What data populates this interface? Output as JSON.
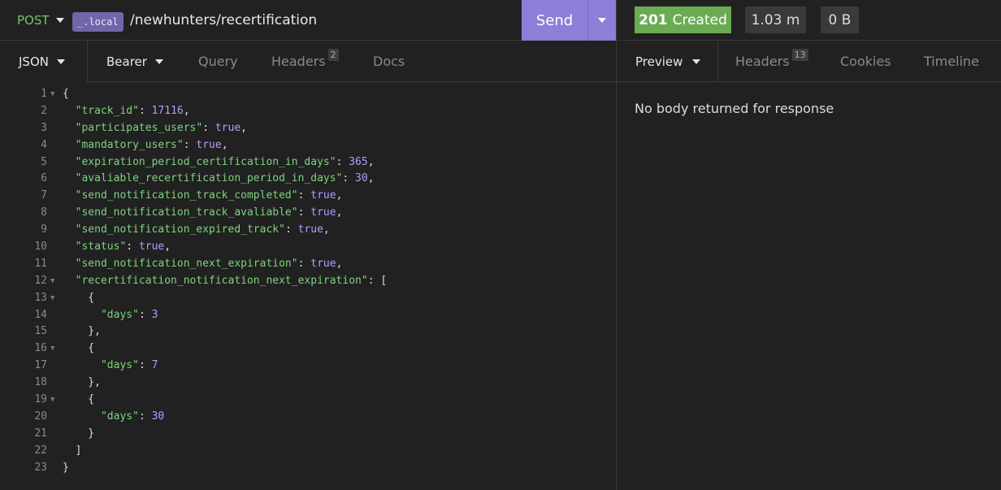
{
  "request": {
    "method": "POST",
    "env_chip": "_.local",
    "path": "/newhunters/recertification",
    "send_label": "Send"
  },
  "request_tabs": {
    "body": "JSON",
    "auth": "Bearer",
    "query": "Query",
    "headers": "Headers",
    "headers_count": "2",
    "docs": "Docs"
  },
  "editor": {
    "lines": [
      {
        "n": "1",
        "fold": "▼",
        "html": "{"
      },
      {
        "n": "2",
        "fold": "",
        "html": "  <span class=\"k\">\"track_id\"</span>: <span class=\"n\">17116</span>,"
      },
      {
        "n": "3",
        "fold": "",
        "html": "  <span class=\"k\">\"participates_users\"</span>: <span class=\"b\">true</span>,"
      },
      {
        "n": "4",
        "fold": "",
        "html": "  <span class=\"k\">\"mandatory_users\"</span>: <span class=\"b\">true</span>,"
      },
      {
        "n": "5",
        "fold": "",
        "html": "  <span class=\"k\">\"expiration_period_certification_in_days\"</span>: <span class=\"n\">365</span>,"
      },
      {
        "n": "6",
        "fold": "",
        "html": "  <span class=\"k\">\"avaliable_recertification_period_in_days\"</span>: <span class=\"n\">30</span>,"
      },
      {
        "n": "7",
        "fold": "",
        "html": "  <span class=\"k\">\"send_notification_track_completed\"</span>: <span class=\"b\">true</span>,"
      },
      {
        "n": "8",
        "fold": "",
        "html": "  <span class=\"k\">\"send_notification_track_avaliable\"</span>: <span class=\"b\">true</span>,"
      },
      {
        "n": "9",
        "fold": "",
        "html": "  <span class=\"k\">\"send_notification_expired_track\"</span>: <span class=\"b\">true</span>,"
      },
      {
        "n": "10",
        "fold": "",
        "html": "  <span class=\"k\">\"status\"</span>: <span class=\"b\">true</span>,"
      },
      {
        "n": "11",
        "fold": "",
        "html": "  <span class=\"k\">\"send_notification_next_expiration\"</span>: <span class=\"b\">true</span>,"
      },
      {
        "n": "12",
        "fold": "▼",
        "html": "  <span class=\"k\">\"recertification_notification_next_expiration\"</span>: ["
      },
      {
        "n": "13",
        "fold": "▼",
        "html": "    {"
      },
      {
        "n": "14",
        "fold": "",
        "html": "      <span class=\"k\">\"days\"</span>: <span class=\"n\">3</span>"
      },
      {
        "n": "15",
        "fold": "",
        "html": "    },"
      },
      {
        "n": "16",
        "fold": "▼",
        "html": "    {"
      },
      {
        "n": "17",
        "fold": "",
        "html": "      <span class=\"k\">\"days\"</span>: <span class=\"n\">7</span>"
      },
      {
        "n": "18",
        "fold": "",
        "html": "    },"
      },
      {
        "n": "19",
        "fold": "▼",
        "html": "    {"
      },
      {
        "n": "20",
        "fold": "",
        "html": "      <span class=\"k\">\"days\"</span>: <span class=\"n\">30</span>"
      },
      {
        "n": "21",
        "fold": "",
        "html": "    }"
      },
      {
        "n": "22",
        "fold": "",
        "html": "  ]"
      },
      {
        "n": "23",
        "fold": "",
        "html": "}"
      }
    ]
  },
  "response": {
    "status_code": "201",
    "status_text": "Created",
    "time": "1.03 m",
    "size": "0 B",
    "empty_message": "No body returned for response"
  },
  "response_tabs": {
    "preview": "Preview",
    "headers": "Headers",
    "headers_count": "13",
    "cookies": "Cookies",
    "timeline": "Timeline"
  },
  "colors": {
    "accent": "#8c7fd8",
    "success": "#6bab53",
    "method": "#79c36a",
    "json_key": "#7fd37c",
    "json_value": "#b49cff"
  }
}
